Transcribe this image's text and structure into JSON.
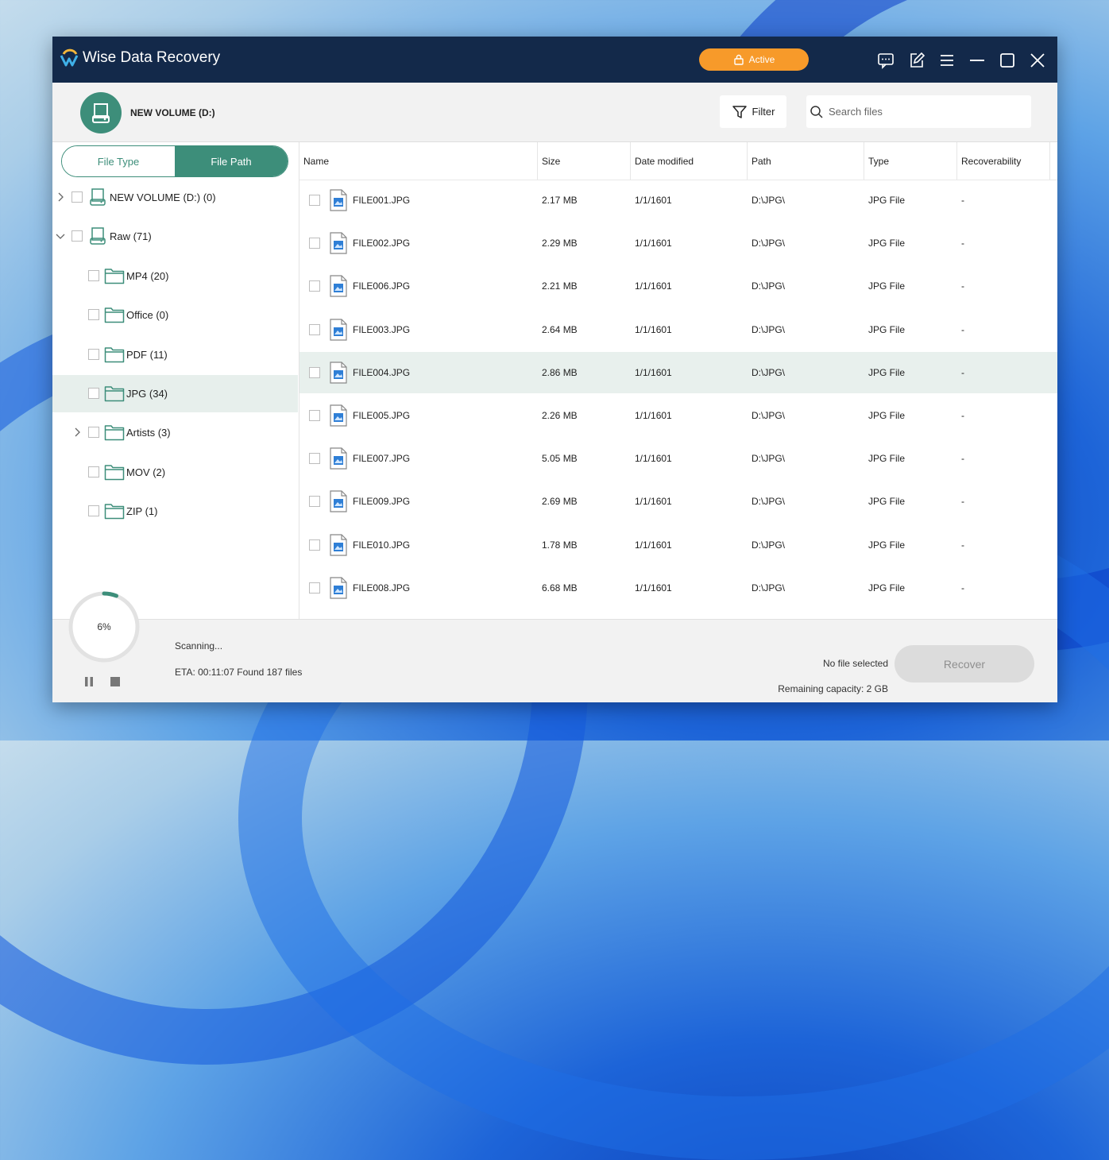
{
  "app": {
    "title": "Wise Data Recovery",
    "active_label": "Active"
  },
  "header": {
    "volume_title": "NEW VOLUME (D:)",
    "filter_label": "Filter",
    "search_placeholder": "Search files"
  },
  "sidebar": {
    "tabs": [
      "File Type",
      "File Path"
    ],
    "selected_tab": "File Path",
    "tree": [
      {
        "label": "NEW VOLUME (D:) (0)",
        "icon": "drive-icon",
        "expander": "chevron-right-icon",
        "level": 0
      },
      {
        "label": "Raw (71)",
        "icon": "drive-icon",
        "expander": "chevron-down-icon",
        "level": 0
      },
      {
        "label": "MP4 (20)",
        "icon": "folder-icon",
        "level": 1
      },
      {
        "label": "Office (0)",
        "icon": "folder-icon",
        "level": 1
      },
      {
        "label": "PDF (11)",
        "icon": "folder-icon",
        "level": 1
      },
      {
        "label": "JPG (34)",
        "icon": "folder-icon",
        "level": 1,
        "selected": true
      },
      {
        "label": "Artists (3)",
        "icon": "folder-icon",
        "expander": "chevron-right-icon",
        "level": 1
      },
      {
        "label": "MOV (2)",
        "icon": "folder-icon",
        "level": 1
      },
      {
        "label": "ZIP (1)",
        "icon": "folder-icon",
        "level": 1
      }
    ]
  },
  "table": {
    "columns": [
      "Name",
      "Size",
      "Date modified",
      "Path",
      "Type",
      "Recoverability"
    ],
    "rows": [
      {
        "name": "FILE001.JPG",
        "size": "2.17 MB",
        "date": "1/1/1601",
        "path": "D:\\JPG\\",
        "type": "JPG File",
        "recoverability": "-"
      },
      {
        "name": "FILE002.JPG",
        "size": "2.29 MB",
        "date": "1/1/1601",
        "path": "D:\\JPG\\",
        "type": "JPG File",
        "recoverability": "-"
      },
      {
        "name": "FILE006.JPG",
        "size": "2.21 MB",
        "date": "1/1/1601",
        "path": "D:\\JPG\\",
        "type": "JPG File",
        "recoverability": "-"
      },
      {
        "name": "FILE003.JPG",
        "size": "2.64 MB",
        "date": "1/1/1601",
        "path": "D:\\JPG\\",
        "type": "JPG File",
        "recoverability": "-"
      },
      {
        "name": "FILE004.JPG",
        "size": "2.86 MB",
        "date": "1/1/1601",
        "path": "D:\\JPG\\",
        "type": "JPG File",
        "recoverability": "-",
        "highlighted": true
      },
      {
        "name": "FILE005.JPG",
        "size": "2.26 MB",
        "date": "1/1/1601",
        "path": "D:\\JPG\\",
        "type": "JPG File",
        "recoverability": "-"
      },
      {
        "name": "FILE007.JPG",
        "size": "5.05 MB",
        "date": "1/1/1601",
        "path": "D:\\JPG\\",
        "type": "JPG File",
        "recoverability": "-"
      },
      {
        "name": "FILE009.JPG",
        "size": "2.69 MB",
        "date": "1/1/1601",
        "path": "D:\\JPG\\",
        "type": "JPG File",
        "recoverability": "-"
      },
      {
        "name": "FILE010.JPG",
        "size": "1.78 MB",
        "date": "1/1/1601",
        "path": "D:\\JPG\\",
        "type": "JPG File",
        "recoverability": "-"
      },
      {
        "name": "FILE008.JPG",
        "size": "6.68 MB",
        "date": "1/1/1601",
        "path": "D:\\JPG\\",
        "type": "JPG File",
        "recoverability": "-"
      }
    ]
  },
  "footer": {
    "progress_label": "6%",
    "progress_fraction": 0.06,
    "scanning_label": "Scanning...",
    "eta_label": "ETA: 00:11:07 Found 187 files",
    "selection_label": "No file selected",
    "recover_label": "Recover",
    "remaining_label": "Remaining capacity: 2 GB"
  },
  "colors": {
    "accent": "#3d8e7a",
    "titlebar": "#13294a",
    "active_button": "#f79a2a",
    "selected_row": "#e8f0ed"
  }
}
